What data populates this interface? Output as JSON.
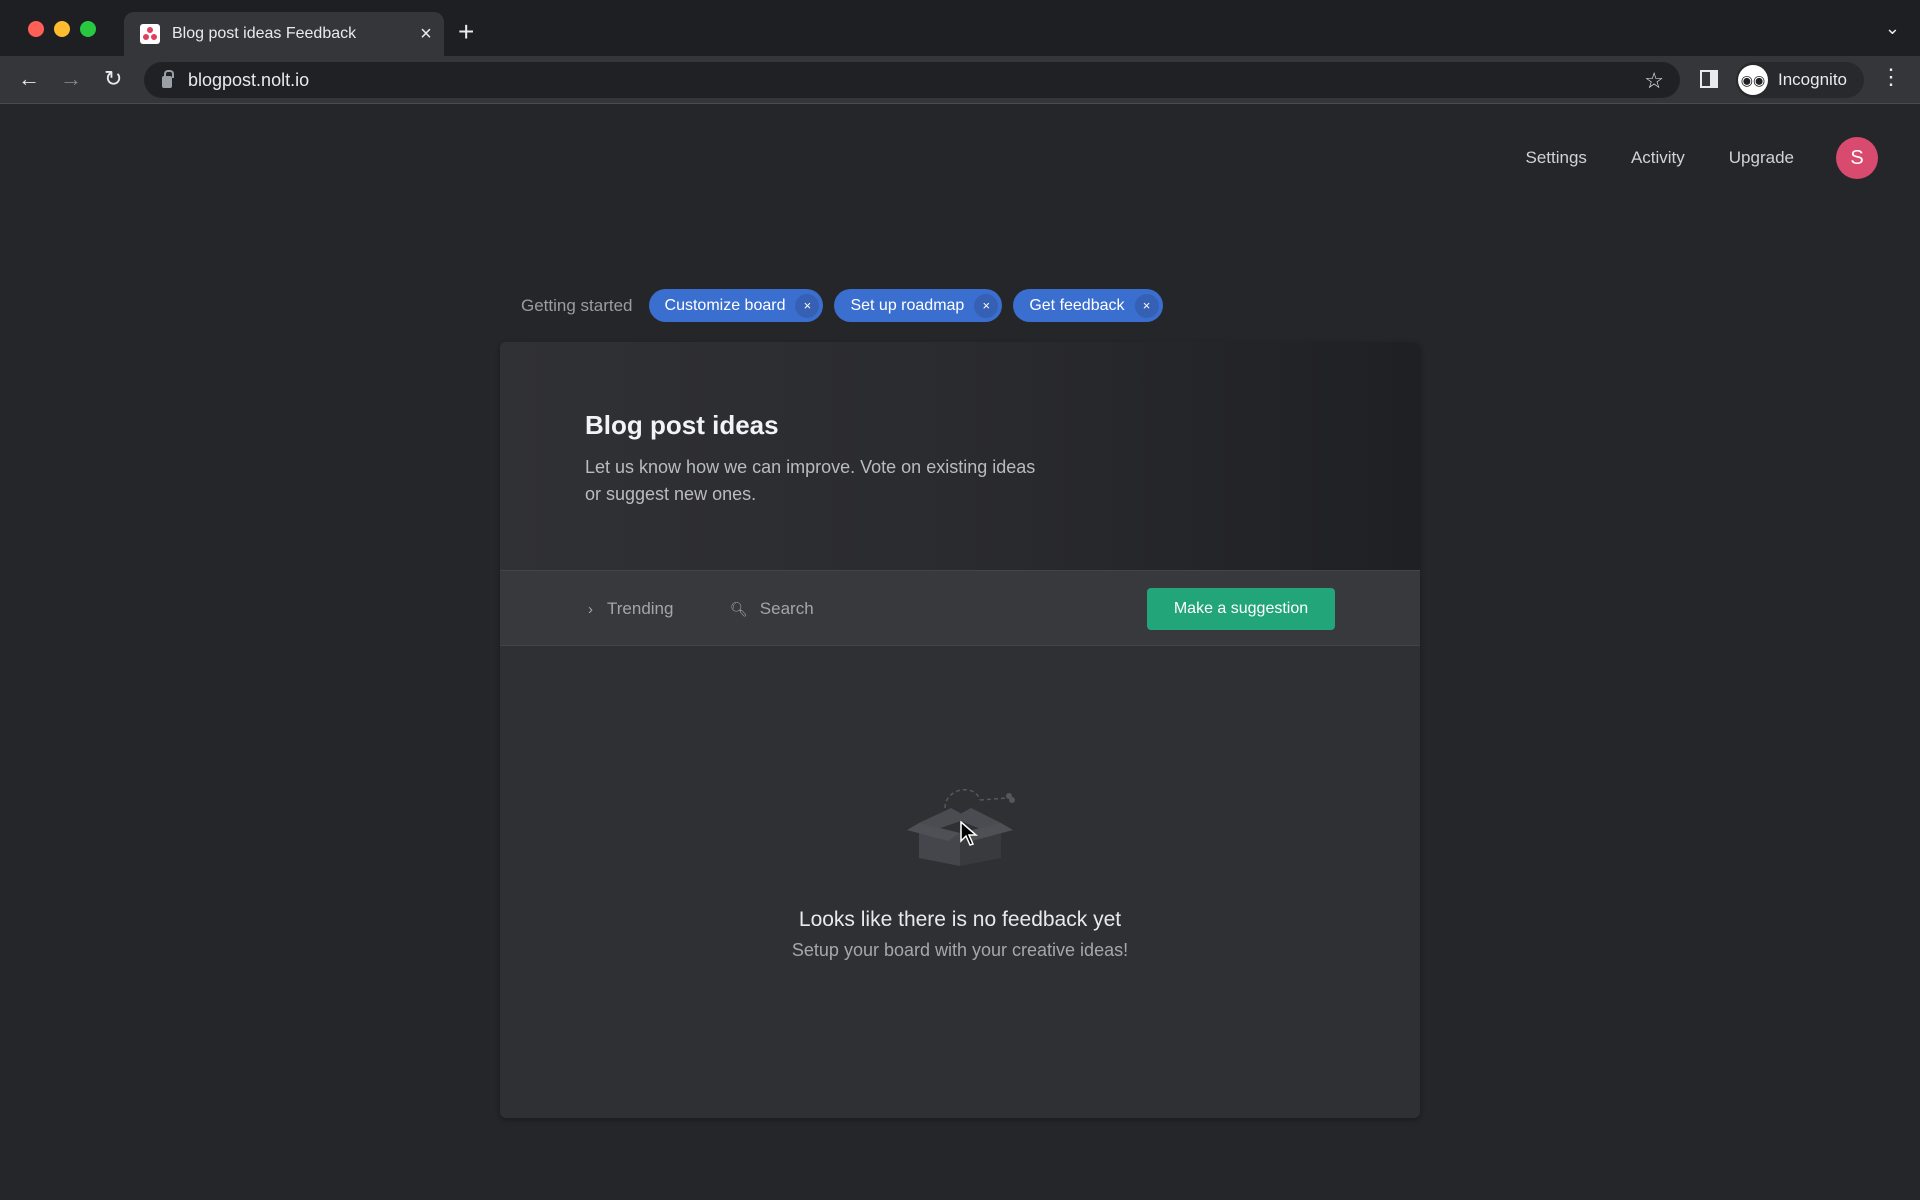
{
  "browser": {
    "tab_title": "Blog post ideas Feedback",
    "new_tab_label": "+",
    "url": "blogpost.nolt.io",
    "profile_label": "Incognito"
  },
  "topnav": {
    "items": [
      {
        "label": "Settings"
      },
      {
        "label": "Activity"
      },
      {
        "label": "Upgrade"
      }
    ],
    "avatar_initial": "S",
    "avatar_color": "#d84a6e"
  },
  "getting_started": {
    "label": "Getting started",
    "chips": [
      {
        "label": "Customize board",
        "close": "×"
      },
      {
        "label": "Set up roadmap",
        "close": "×"
      },
      {
        "label": "Get feedback",
        "close": "×"
      }
    ],
    "chip_color": "#3b6fcf"
  },
  "board": {
    "title": "Blog post ideas",
    "description": "Let us know how we can improve. Vote on existing ideas or suggest new ones.",
    "sort_label": "Trending",
    "search_placeholder": "Search",
    "suggest_button": "Make a suggestion",
    "accent_color": "#23a57a",
    "empty_title": "Looks like there is no feedback yet",
    "empty_subtitle": "Setup your board with your creative ideas!"
  }
}
